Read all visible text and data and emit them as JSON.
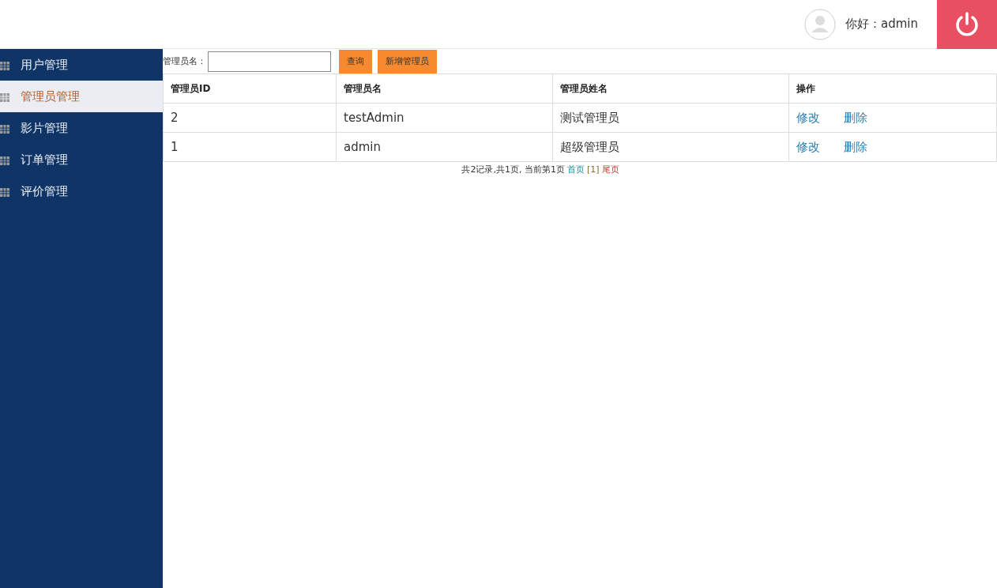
{
  "header": {
    "greeting": "你好：admin"
  },
  "sidebar": {
    "items": [
      {
        "label": "用户管理",
        "selected": false
      },
      {
        "label": "管理员管理",
        "selected": true
      },
      {
        "label": "影片管理",
        "selected": false
      },
      {
        "label": "订单管理",
        "selected": false
      },
      {
        "label": "评价管理",
        "selected": false
      }
    ]
  },
  "search": {
    "label": "管理员名：",
    "buttons": [
      "查询",
      "新增管理员"
    ]
  },
  "table": {
    "columns": [
      "管理员ID",
      "管理员名",
      "管理员姓名",
      "操作"
    ],
    "rows": [
      {
        "cells": [
          "2",
          "testAdmin",
          "测试管理员"
        ],
        "actions": [
          "修改",
          "删除"
        ]
      },
      {
        "cells": [
          "1",
          "admin",
          "超级管理员"
        ],
        "actions": [
          "修改",
          "删除"
        ]
      }
    ]
  },
  "pagination": {
    "summary": "共2记录,共1页, 当前第1页",
    "first": "首页",
    "current": "[1]",
    "last": "尾页"
  }
}
